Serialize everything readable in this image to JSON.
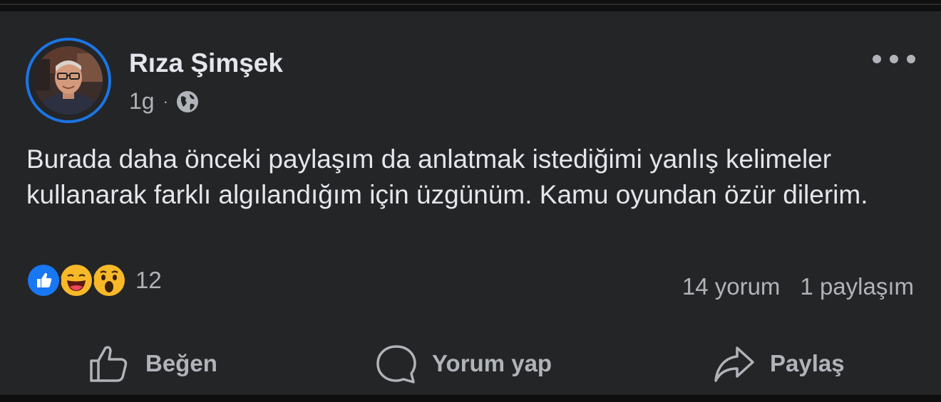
{
  "post": {
    "author": "Rıza Şimşek",
    "time": "1g",
    "separator": "·",
    "visibility_icon": "globe-icon",
    "more_icon": "more-options-icon",
    "text": "Burada daha önceki paylaşım da anlatmak istediğimi yanlış kelimeler kullanarak farklı algılandığım için üzgünüm. Kamu oyundan özür dilerim."
  },
  "reactions": {
    "types": [
      "like-reaction-icon",
      "haha-reaction-icon",
      "wow-reaction-icon"
    ],
    "count": "12",
    "comments": "14 yorum",
    "shares": "1 paylaşım"
  },
  "actions": {
    "like_label": "Beğen",
    "comment_label": "Yorum yap",
    "share_label": "Paylaş"
  },
  "colors": {
    "card_bg": "#242527",
    "text_primary": "#e4e6eb",
    "text_secondary": "#b0b3b8",
    "accent_blue": "#1b74e4"
  }
}
